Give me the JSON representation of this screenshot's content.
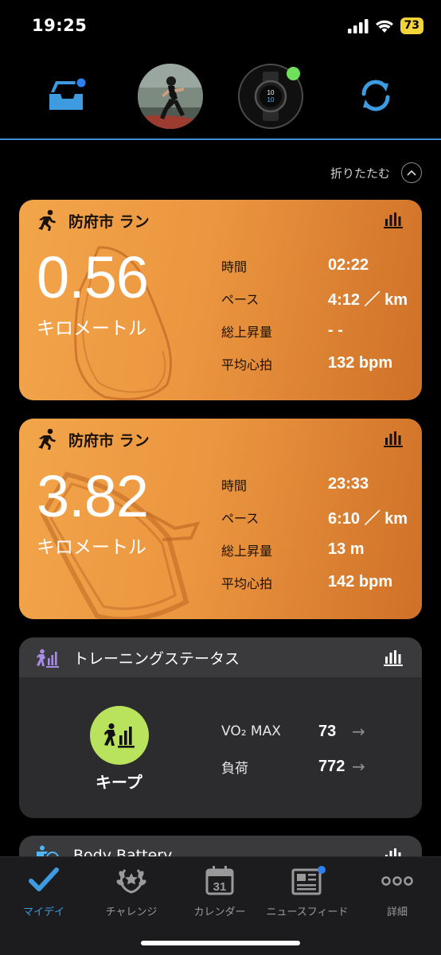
{
  "status": {
    "time": "19:25",
    "battery": "73"
  },
  "collapse": {
    "label": "折りたたむ"
  },
  "activities": [
    {
      "title": "防府市 ラン",
      "distance": "0.56",
      "unit": "キロメートル",
      "stats": [
        {
          "label": "時間",
          "value": "02:22"
        },
        {
          "label": "ペース",
          "value": "4:12 ／ km"
        },
        {
          "label": "総上昇量",
          "value": "- -"
        },
        {
          "label": "平均心拍",
          "value": "132 bpm"
        }
      ]
    },
    {
      "title": "防府市 ラン",
      "distance": "3.82",
      "unit": "キロメートル",
      "stats": [
        {
          "label": "時間",
          "value": "23:33"
        },
        {
          "label": "ペース",
          "value": "6:10 ／ km"
        },
        {
          "label": "総上昇量",
          "value": "13 m"
        },
        {
          "label": "平均心拍",
          "value": "142 bpm"
        }
      ]
    }
  ],
  "training": {
    "title": "トレーニングステータス",
    "state": "キープ",
    "stats": [
      {
        "label": "VO₂ MAX",
        "value": "73"
      },
      {
        "label": "負荷",
        "value": "772"
      }
    ]
  },
  "body_battery": {
    "title": "Body Battery"
  },
  "tabs": [
    {
      "label": "マイデイ",
      "icon": "check-icon"
    },
    {
      "label": "チャレンジ",
      "icon": "laurel-icon"
    },
    {
      "label": "カレンダー",
      "icon": "calendar-icon",
      "day": "31"
    },
    {
      "label": "ニュースフィード",
      "icon": "newspaper-icon"
    },
    {
      "label": "詳細",
      "icon": "more-icon"
    }
  ],
  "colors": {
    "accent": "#3e9be0",
    "card_orange": "#eb9640",
    "training_green": "#b9e35c",
    "notify_blue": "#2f80ed",
    "device_online": "#6fe05a"
  }
}
